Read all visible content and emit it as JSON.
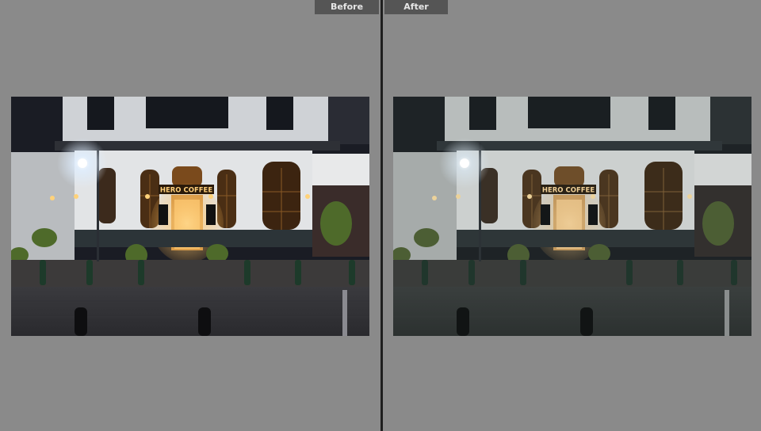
{
  "labels": {
    "before": "Before",
    "after": "After"
  },
  "sign": {
    "text": "HERO COFFEE"
  },
  "colors": {
    "background": "#8a8a8a",
    "label_background": "#555555",
    "label_text": "#e6e6e6",
    "divider": "#1f1f1f",
    "warm_light": "#f2b35a",
    "street_lamp": "#dfeeff"
  },
  "panels": [
    {
      "id": "before",
      "tone": "warm-vivid"
    },
    {
      "id": "after",
      "tone": "muted-cool"
    }
  ]
}
